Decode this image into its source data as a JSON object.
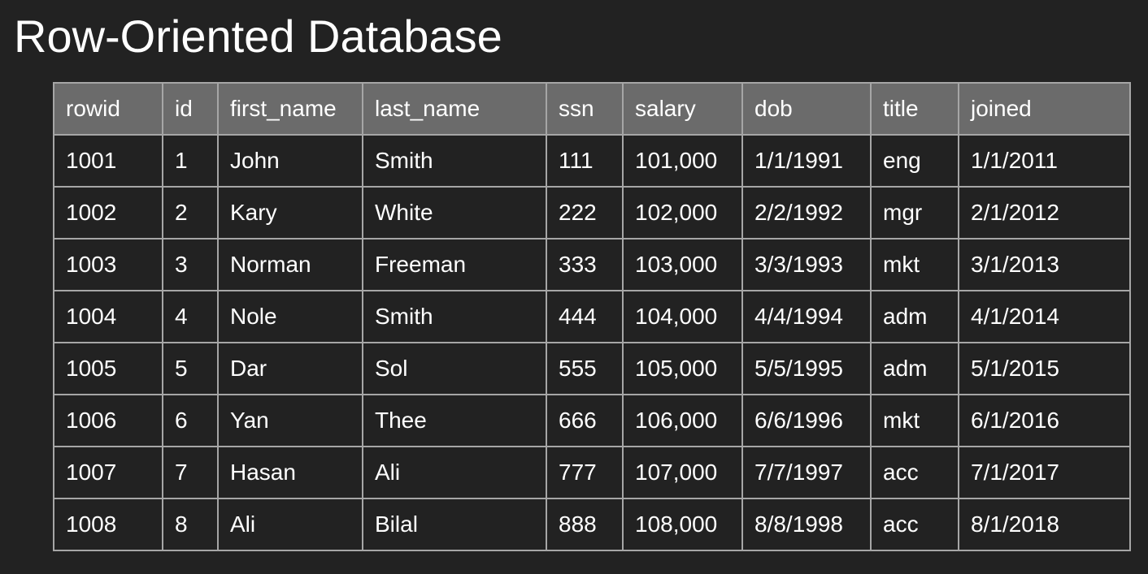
{
  "page": {
    "title": "Row-Oriented Database"
  },
  "colors": {
    "background": "#222222",
    "header_fill": "#6b6b6b",
    "grid_line": "#a6a6a6",
    "text": "#ffffff"
  },
  "table": {
    "columns": [
      "rowid",
      "id",
      "first_name",
      "last_name",
      "ssn",
      "salary",
      "dob",
      "title",
      "joined"
    ],
    "rows": [
      [
        "1001",
        "1",
        "John",
        "Smith",
        "111",
        "101,000",
        "1/1/1991",
        "eng",
        "1/1/2011"
      ],
      [
        "1002",
        "2",
        "Kary",
        "White",
        "222",
        "102,000",
        "2/2/1992",
        "mgr",
        "2/1/2012"
      ],
      [
        "1003",
        "3",
        "Norman",
        "Freeman",
        "333",
        "103,000",
        "3/3/1993",
        "mkt",
        "3/1/2013"
      ],
      [
        "1004",
        "4",
        "Nole",
        "Smith",
        "444",
        "104,000",
        "4/4/1994",
        "adm",
        "4/1/2014"
      ],
      [
        "1005",
        "5",
        "Dar",
        "Sol",
        "555",
        "105,000",
        "5/5/1995",
        "adm",
        "5/1/2015"
      ],
      [
        "1006",
        "6",
        "Yan",
        "Thee",
        "666",
        "106,000",
        "6/6/1996",
        "mkt",
        "6/1/2016"
      ],
      [
        "1007",
        "7",
        "Hasan",
        "Ali",
        "777",
        "107,000",
        "7/7/1997",
        "acc",
        "7/1/2017"
      ],
      [
        "1008",
        "8",
        "Ali",
        "Bilal",
        "888",
        "108,000",
        "8/8/1998",
        "acc",
        "8/1/2018"
      ]
    ]
  }
}
